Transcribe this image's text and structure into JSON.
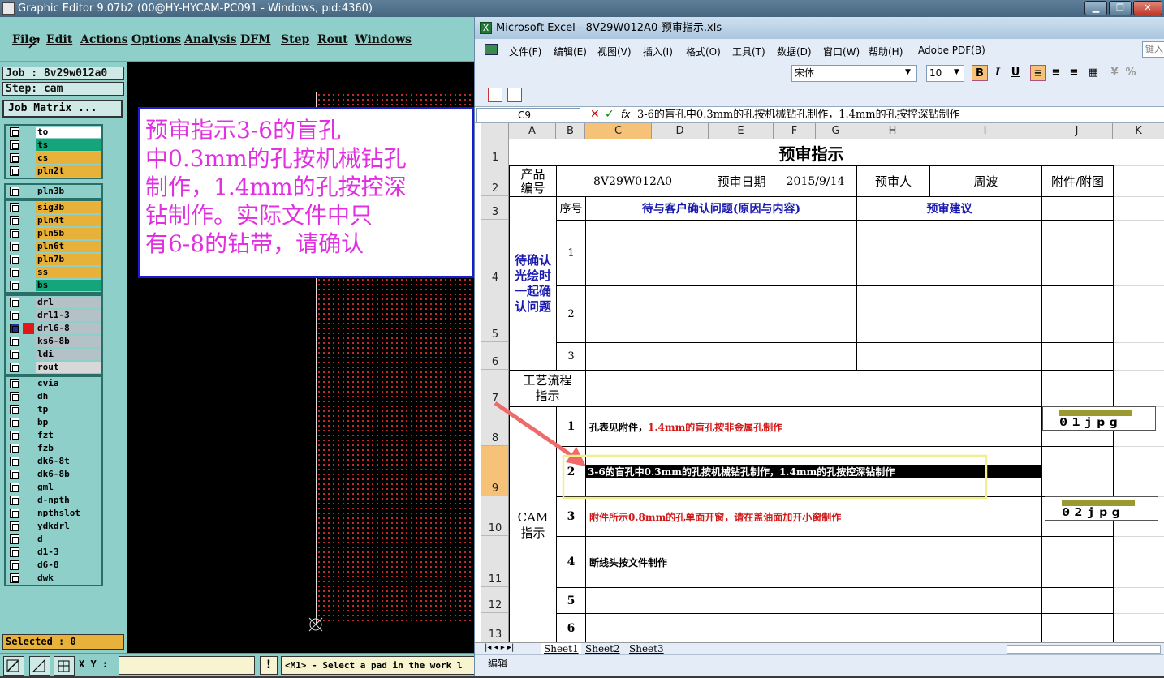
{
  "ge": {
    "title": "Graphic Editor 9.07b2 (00@HY-HYCAM-PC091 - Windows, pid:4360)",
    "menu": [
      "File",
      "Edit",
      "Actions",
      "Options",
      "Analysis",
      "DFM",
      "Step",
      "Rout",
      "Windows"
    ],
    "job_label": "Job : 8v29w012a0",
    "step_label": "Step: cam",
    "job_matrix": "Job Matrix ...",
    "layer_groups": [
      [
        {
          "name": "to",
          "color": "#ffffff"
        },
        {
          "name": "ts",
          "color": "#14a57a"
        },
        {
          "name": "cs",
          "color": "#e8b23a"
        },
        {
          "name": "pln2t",
          "color": "#e8b23a"
        }
      ],
      [
        {
          "name": "pln3b",
          "color": "#8fcfca"
        }
      ],
      [
        {
          "name": "sig3b",
          "color": "#e8b23a"
        },
        {
          "name": "pln4t",
          "color": "#e8b23a"
        },
        {
          "name": "pln5b",
          "color": "#e8b23a"
        },
        {
          "name": "pln6t",
          "color": "#e8b23a"
        },
        {
          "name": "pln7b",
          "color": "#e8b23a"
        },
        {
          "name": "ss",
          "color": "#e8b23a"
        },
        {
          "name": "bs",
          "color": "#14a57a"
        }
      ],
      [
        {
          "name": "drl",
          "color": "#b4c2c8"
        },
        {
          "name": "drl1-3",
          "color": "#b4c2c8"
        },
        {
          "name": "drl6-8",
          "color": "#b4c2c8"
        },
        {
          "name": "ks6-8b",
          "color": "#b4c2c8"
        },
        {
          "name": "ldi",
          "color": "#b4c2c8"
        },
        {
          "name": "rout",
          "color": "#d8d8d8"
        }
      ],
      [
        {
          "name": "cvia",
          "color": "#8fcfca"
        },
        {
          "name": "dh",
          "color": "#8fcfca"
        },
        {
          "name": "tp",
          "color": "#8fcfca"
        },
        {
          "name": "bp",
          "color": "#8fcfca"
        },
        {
          "name": "fzt",
          "color": "#8fcfca"
        },
        {
          "name": "fzb",
          "color": "#8fcfca"
        },
        {
          "name": "dk6-8t",
          "color": "#8fcfca"
        },
        {
          "name": "dk6-8b",
          "color": "#8fcfca"
        },
        {
          "name": "gml",
          "color": "#8fcfca"
        },
        {
          "name": "d-npth",
          "color": "#8fcfca"
        },
        {
          "name": "npthslot",
          "color": "#8fcfca"
        },
        {
          "name": "ydkdrl",
          "color": "#8fcfca"
        },
        {
          "name": "d",
          "color": "#8fcfca"
        },
        {
          "name": "d1-3",
          "color": "#8fcfca"
        },
        {
          "name": "d6-8",
          "color": "#8fcfca"
        },
        {
          "name": "dwk",
          "color": "#8fcfca"
        }
      ]
    ],
    "selected": "Selected : 0",
    "xy_label": "X Y :",
    "message": "<M1> - Select a pad in the work l",
    "note": "预审指示3-6的盲孔\n中0.3mm的孔按机械钻孔\n制作，1.4mm的孔按控深\n钻制作。实际文件中只\n有6-8的钻带，请确认"
  },
  "excel": {
    "title": "Microsoft Excel - 8V29W012A0-预审指示.xls",
    "menu": [
      "文件(F)",
      "编辑(E)",
      "视图(V)",
      "插入(I)",
      "格式(O)",
      "工具(T)",
      "数据(D)",
      "窗口(W)",
      "帮助(H)",
      "Adobe PDF(B)"
    ],
    "help_box": "键入",
    "font_name": "宋体",
    "font_size": "10",
    "name_box": "C9",
    "formula": "3-6的盲孔中0.3mm的孔按机械钻孔制作，1.4mm的孔按控深钻制作",
    "columns": [
      "A",
      "B",
      "C",
      "D",
      "E",
      "F",
      "G",
      "H",
      "I",
      "J",
      "K"
    ],
    "rows": [
      "1",
      "2",
      "3",
      "4",
      "5",
      "6",
      "7",
      "8",
      "9",
      "10",
      "11",
      "12",
      "13"
    ],
    "sheet": {
      "title": "预审指示",
      "product_no_label": "产品\n编号",
      "product_no": "8V29W012A0",
      "review_date_label": "预审日期",
      "review_date": "2015/9/14",
      "reviewer_label": "预审人",
      "reviewer": "周波",
      "attach_label": "附件/附图",
      "seq_label": "序号",
      "issue_header": "待与客户确认问题(原因与内容)",
      "suggest_header": "预审建议",
      "confirm_label": "待确认\n光绘时\n一起确\n认问题",
      "process_label": "工艺流程\n指示",
      "cam_label": "CAM\n指示",
      "issue_nums": [
        "1",
        "2",
        "3"
      ],
      "cam_items": [
        {
          "num": "1",
          "text": "孔表见附件，",
          "text_red": "1.4mm的盲孔按非金属孔制作"
        },
        {
          "num": "2",
          "text": "3-6的盲孔中0.3mm的孔按机械钻孔制作，1.4mm的孔按控深钻制作",
          "text_red": ""
        },
        {
          "num": "3",
          "text": "",
          "text_red": "附件所示0.8mm的孔单面开窗，请在盖油面加开小窗制作"
        },
        {
          "num": "4",
          "text": "断线头按文件制作",
          "text_red": ""
        },
        {
          "num": "5",
          "text": "",
          "text_red": ""
        },
        {
          "num": "6",
          "text": "",
          "text_red": ""
        }
      ],
      "attach_1": "01jpg",
      "attach_2": "02jpg"
    },
    "tabs": [
      "Sheet1",
      "Sheet2",
      "Sheet3"
    ],
    "status": "编辑"
  }
}
